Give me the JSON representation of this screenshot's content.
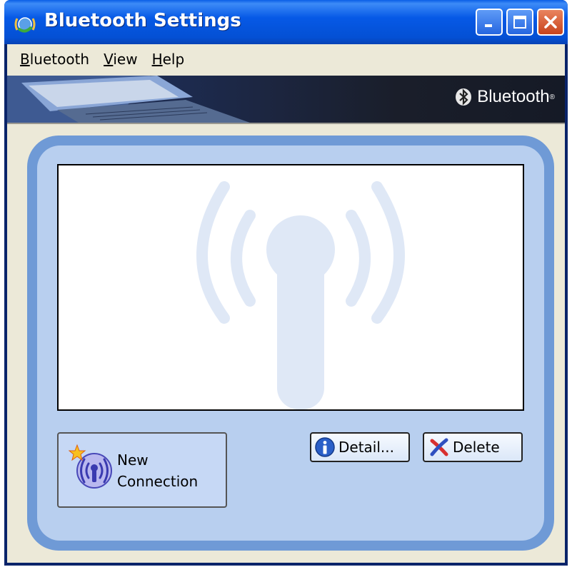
{
  "window": {
    "title": "Bluetooth Settings"
  },
  "menu": [
    {
      "mnemonic": "B",
      "rest": "luetooth"
    },
    {
      "mnemonic": "V",
      "rest": "iew"
    },
    {
      "mnemonic": "H",
      "rest": "elp"
    }
  ],
  "banner": {
    "brand": "Bluetooth",
    "reg": "®"
  },
  "buttons": {
    "new_connection": "New\nConnection",
    "detail": "Detail...",
    "delete": "Delete"
  },
  "colors": {
    "titlebar": "#0450d4",
    "panel_outer": "#6f9ad6",
    "panel_inner": "#b8cfef",
    "client_bg": "#ece9d8"
  }
}
